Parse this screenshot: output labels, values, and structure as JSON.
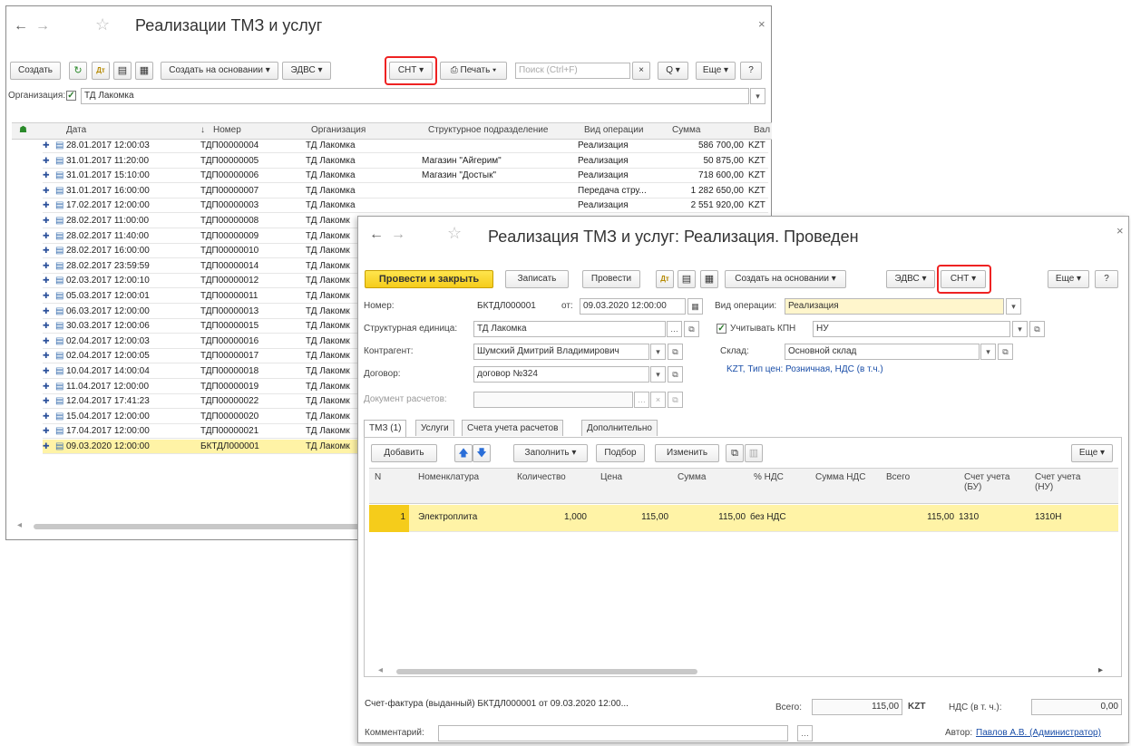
{
  "list_window": {
    "title": "Реализации ТМЗ и услуг",
    "toolbar": {
      "create": "Создать",
      "create_based": "Создать на основании ▾",
      "edvs": "ЭДВС ▾",
      "snt": "СНТ ▾",
      "print": "Печать ▾",
      "search_placeholder": "Поиск (Ctrl+F)",
      "clear": "×",
      "search_btn": "Q ▾",
      "more": "Еще ▾",
      "help": "?"
    },
    "org_filter": {
      "label": "Организация:",
      "checked": "✓",
      "value": "ТД Лакомка",
      "arrow": "▾"
    },
    "columns": [
      "Дата",
      "↓",
      "Номер",
      "Организация",
      "Структурное подразделение",
      "Вид операции",
      "Сумма",
      "Вал"
    ],
    "rows": [
      {
        "date": "28.01.2017 12:00:03",
        "number": "ТДП00000004",
        "org": "ТД Лакомка",
        "unit": "",
        "op": "Реализация",
        "sum": "586 700,00",
        "cur": "KZT"
      },
      {
        "date": "31.01.2017 11:20:00",
        "number": "ТДП00000005",
        "org": "ТД Лакомка",
        "unit": "Магазин \"Айгерим\"",
        "op": "Реализация",
        "sum": "50 875,00",
        "cur": "KZT"
      },
      {
        "date": "31.01.2017 15:10:00",
        "number": "ТДП00000006",
        "org": "ТД Лакомка",
        "unit": "Магазин \"Достык\"",
        "op": "Реализация",
        "sum": "718 600,00",
        "cur": "KZT"
      },
      {
        "date": "31.01.2017 16:00:00",
        "number": "ТДП00000007",
        "org": "ТД Лакомка",
        "unit": "",
        "op": "Передача стру...",
        "sum": "1 282 650,00",
        "cur": "KZT"
      },
      {
        "date": "17.02.2017 12:00:00",
        "number": "ТДП00000003",
        "org": "ТД Лакомка",
        "unit": "",
        "op": "Реализация",
        "sum": "2 551 920,00",
        "cur": "KZT"
      },
      {
        "date": "28.02.2017 11:00:00",
        "number": "ТДП00000008",
        "org": "ТД Лакомк",
        "unit": "",
        "op": "",
        "sum": "",
        "cur": ""
      },
      {
        "date": "28.02.2017 11:40:00",
        "number": "ТДП00000009",
        "org": "ТД Лакомк",
        "unit": "",
        "op": "",
        "sum": "",
        "cur": ""
      },
      {
        "date": "28.02.2017 16:00:00",
        "number": "ТДП00000010",
        "org": "ТД Лакомк",
        "unit": "",
        "op": "",
        "sum": "",
        "cur": ""
      },
      {
        "date": "28.02.2017 23:59:59",
        "number": "ТДП00000014",
        "org": "ТД Лакомк",
        "unit": "",
        "op": "",
        "sum": "",
        "cur": ""
      },
      {
        "date": "02.03.2017 12:00:10",
        "number": "ТДП00000012",
        "org": "ТД Лакомк",
        "unit": "",
        "op": "",
        "sum": "",
        "cur": ""
      },
      {
        "date": "05.03.2017 12:00:01",
        "number": "ТДП00000011",
        "org": "ТД Лакомк",
        "unit": "",
        "op": "",
        "sum": "",
        "cur": ""
      },
      {
        "date": "06.03.2017 12:00:00",
        "number": "ТДП00000013",
        "org": "ТД Лакомк",
        "unit": "",
        "op": "",
        "sum": "",
        "cur": ""
      },
      {
        "date": "30.03.2017 12:00:06",
        "number": "ТДП00000015",
        "org": "ТД Лакомк",
        "unit": "",
        "op": "",
        "sum": "",
        "cur": ""
      },
      {
        "date": "02.04.2017 12:00:03",
        "number": "ТДП00000016",
        "org": "ТД Лакомк",
        "unit": "",
        "op": "",
        "sum": "",
        "cur": ""
      },
      {
        "date": "02.04.2017 12:00:05",
        "number": "ТДП00000017",
        "org": "ТД Лакомк",
        "unit": "",
        "op": "",
        "sum": "",
        "cur": ""
      },
      {
        "date": "10.04.2017 14:00:04",
        "number": "ТДП00000018",
        "org": "ТД Лакомк",
        "unit": "",
        "op": "",
        "sum": "",
        "cur": ""
      },
      {
        "date": "11.04.2017 12:00:00",
        "number": "ТДП00000019",
        "org": "ТД Лакомк",
        "unit": "",
        "op": "",
        "sum": "",
        "cur": ""
      },
      {
        "date": "12.04.2017 17:41:23",
        "number": "ТДП00000022",
        "org": "ТД Лакомк",
        "unit": "",
        "op": "",
        "sum": "",
        "cur": ""
      },
      {
        "date": "15.04.2017 12:00:00",
        "number": "ТДП00000020",
        "org": "ТД Лакомк",
        "unit": "",
        "op": "",
        "sum": "",
        "cur": ""
      },
      {
        "date": "17.04.2017 12:00:00",
        "number": "ТДП00000021",
        "org": "ТД Лакомк",
        "unit": "",
        "op": "",
        "sum": "",
        "cur": ""
      },
      {
        "date": "09.03.2020 12:00:00",
        "number": "БКТДЛ000001",
        "org": "ТД Лакомк",
        "unit": "",
        "op": "",
        "sum": "",
        "cur": ""
      }
    ]
  },
  "doc_window": {
    "title": "Реализация ТМЗ и услуг: Реализация. Проведен",
    "toolbar": {
      "post_close": "Провести и закрыть",
      "save": "Записать",
      "post": "Провести",
      "create_based": "Создать на основании ▾",
      "edvs": "ЭДВС ▾",
      "snt": "СНТ ▾",
      "more": "Еще ▾",
      "help": "?"
    },
    "fields": {
      "number_label": "Номер:",
      "number": "БКТДЛ000001",
      "from_label": "от:",
      "date": "09.03.2020 12:00:00",
      "op_label": "Вид операции:",
      "op": "Реализация",
      "unit_label": "Структурная единица:",
      "unit": "ТД Лакомка",
      "kpn_label": "Учитывать КПН",
      "kpn": "НУ",
      "counterparty_label": "Контрагент:",
      "counterparty": "Шумский Дмитрий Владимирович",
      "warehouse_label": "Склад:",
      "warehouse": "Основной склад",
      "contract_label": "Договор:",
      "contract": "договор №324",
      "price_link": "KZT, Тип цен: Розничная, НДС (в т.ч.)",
      "settlement_label": "Документ расчетов:"
    },
    "tabs": [
      "ТМЗ (1)",
      "Услуги",
      "Счета учета расчетов",
      "Дополнительно"
    ],
    "grid_toolbar": {
      "add": "Добавить",
      "fill": "Заполнить ▾",
      "select": "Подбор",
      "change": "Изменить",
      "more": "Еще ▾"
    },
    "grid_columns": [
      "N",
      "Номенклатура",
      "Количество",
      "Цена",
      "Сумма",
      "% НДС",
      "Сумма НДС",
      "Всего",
      "Счет учета (БУ)",
      "Счет учета (НУ)"
    ],
    "grid_rows": [
      {
        "n": "1",
        "item": "Электроплита",
        "qty": "1,000",
        "price": "115,00",
        "sum": "115,00",
        "vat": "без НДС",
        "vat_sum": "",
        "total": "115,00",
        "acc_bu": "1310",
        "acc_nu": "1310Н"
      }
    ],
    "footer": {
      "invoice_link": "Счет-фактура (выданный) БКТДЛ000001 от 09.03.2020 12:00...",
      "total_label": "Всего:",
      "total": "115,00",
      "currency": "KZT",
      "vat_label": "НДС (в т. ч.):",
      "vat": "0,00",
      "comment_label": "Комментарий:",
      "author_label": "Автор:",
      "author": "Павлов А.В. (Администратор)"
    }
  },
  "colors": {
    "accent_yellow": "#f5cc1b",
    "selected_row": "#fff3a6",
    "highlight": "#e22222",
    "link": "#1a4ea8"
  }
}
